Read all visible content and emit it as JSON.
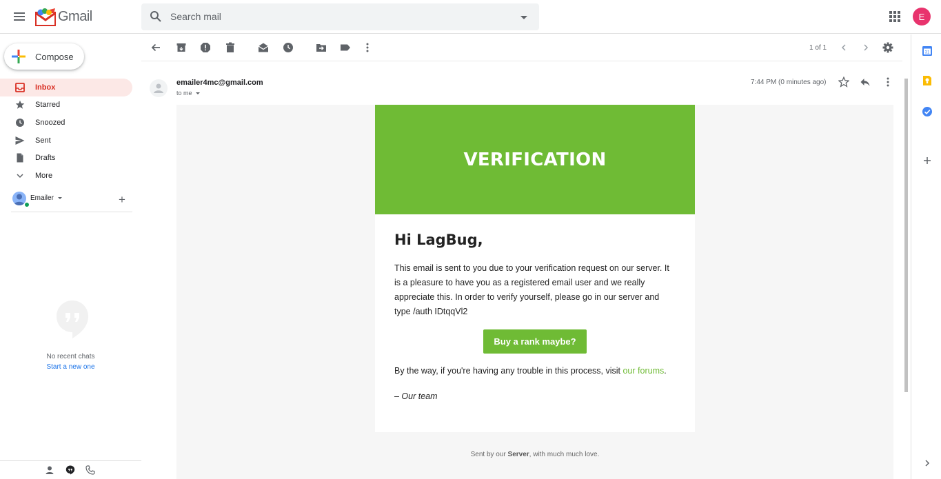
{
  "app": {
    "name": "Gmail",
    "account_initial": "E"
  },
  "search": {
    "placeholder": "Search mail"
  },
  "compose": {
    "label": "Compose"
  },
  "nav": {
    "items": [
      {
        "label": "Inbox",
        "icon": "inbox-icon",
        "active": true
      },
      {
        "label": "Starred",
        "icon": "star-icon"
      },
      {
        "label": "Snoozed",
        "icon": "clock-icon"
      },
      {
        "label": "Sent",
        "icon": "send-icon"
      },
      {
        "label": "Drafts",
        "icon": "draft-icon"
      },
      {
        "label": "More",
        "icon": "chevron-down-icon"
      }
    ]
  },
  "hangouts": {
    "account_name": "Emailer",
    "empty_text": "No recent chats",
    "start_link": "Start a new one"
  },
  "toolbar": {
    "pager": "1 of 1"
  },
  "message": {
    "sender": "emailer4mc@gmail.com",
    "to": "to me",
    "time": "7:44 PM (0 minutes ago)"
  },
  "email": {
    "banner_title": "VERIFICATION",
    "greeting": "Hi LagBug,",
    "body": "This email is sent to you due to your verification request on our server. It is a pleasure to have you as a registered email user and we really appreciate this. In order to verify yourself, please go in our server and type /auth IDtqqVl2",
    "button_label": "Buy a rank maybe?",
    "trouble_prefix": "By the way, if you're having any trouble in this process, visit ",
    "trouble_link": "our forums",
    "trouble_suffix": ".",
    "signoff": "– Our team",
    "footer_prefix": "Sent by our ",
    "footer_bold": "Server",
    "footer_suffix": ", with much much love."
  },
  "colors": {
    "accent_green": "#6fbb35",
    "inbox_red": "#d93025",
    "avatar_pink": "#e8336d",
    "link_blue": "#1a73e8"
  }
}
